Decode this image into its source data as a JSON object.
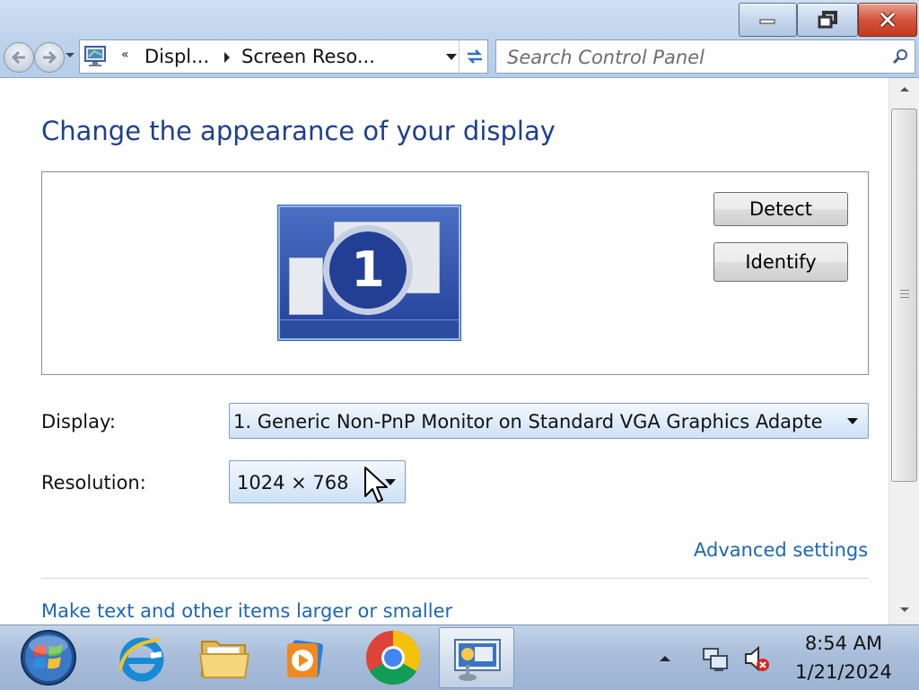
{
  "window": {
    "minimize_icon": "minimize-icon",
    "maximize_icon": "restore-icon",
    "close_icon": "close-icon"
  },
  "navigation": {
    "back_icon": "back-arrow-icon",
    "forward_icon": "forward-arrow-icon"
  },
  "address": {
    "overflow_chevron": "«",
    "crumbs": [
      "Displ...",
      "Screen Reso..."
    ]
  },
  "search": {
    "placeholder": "Search Control Panel"
  },
  "main": {
    "title": "Change the appearance of your display",
    "monitor_number": "1",
    "detect_label": "Detect",
    "identify_label": "Identify",
    "display_label": "Display:",
    "display_value": "1. Generic Non-PnP Monitor on Standard VGA Graphics Adapte",
    "resolution_label": "Resolution:",
    "resolution_value": "1024 × 768",
    "advanced_link": "Advanced settings",
    "larger_link": "Make text and other items larger or smaller"
  },
  "taskbar": {
    "apps": [
      "internet-explorer",
      "windows-explorer",
      "windows-media-player",
      "google-chrome",
      "control-panel-display"
    ],
    "time": "8:54 AM",
    "date": "1/21/2024"
  },
  "colors": {
    "title_blue": "#1e3f8f",
    "link_blue": "#1e66b5",
    "close_red": "#c4391d"
  }
}
